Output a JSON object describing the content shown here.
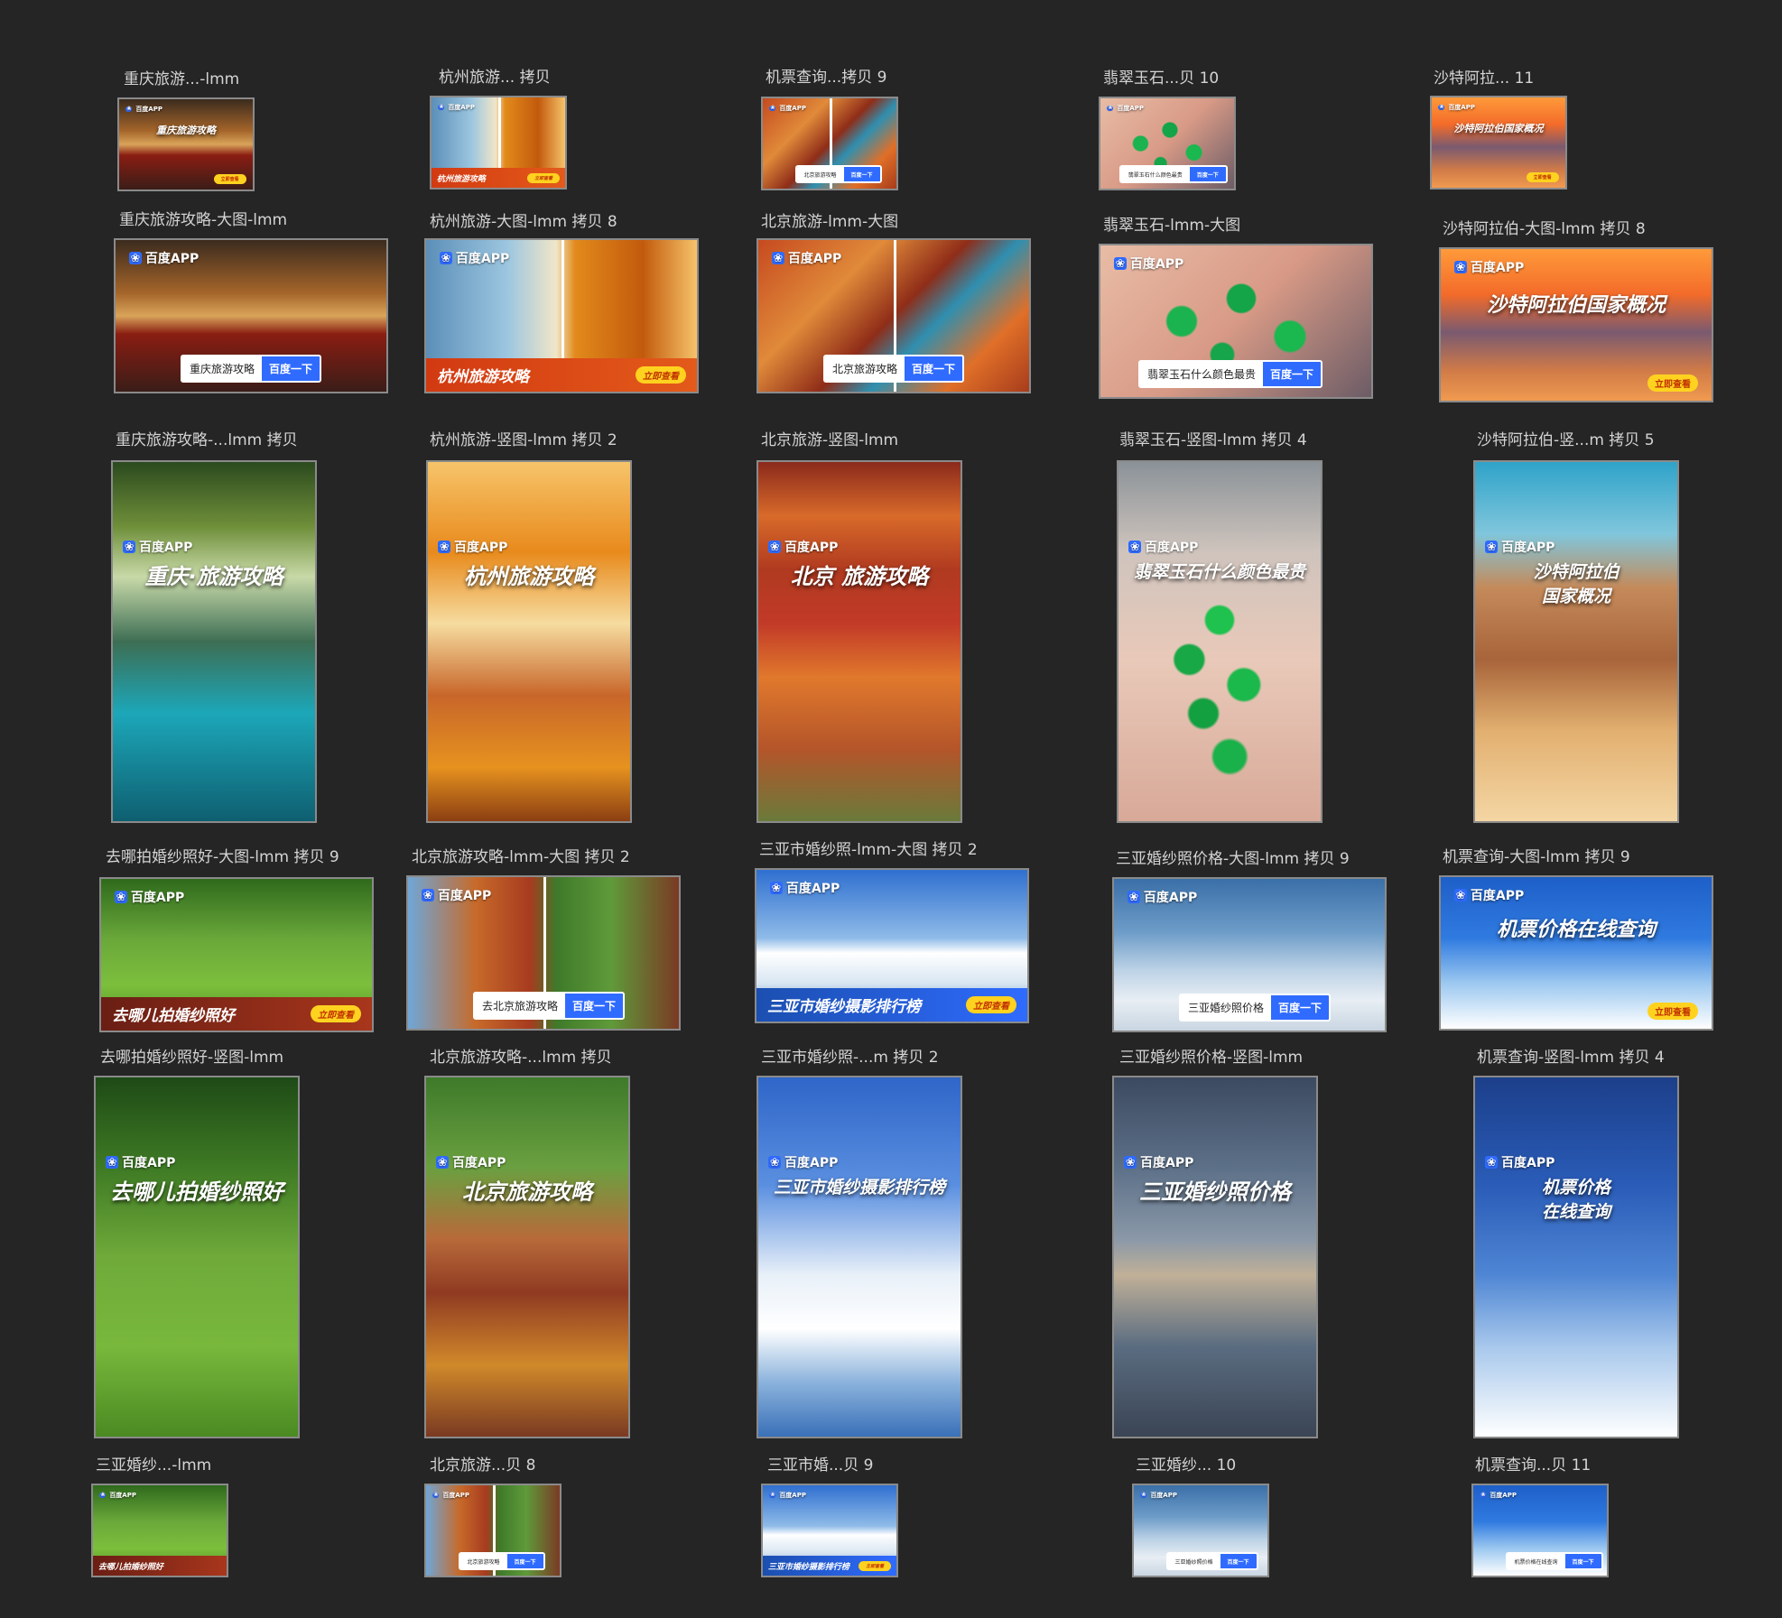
{
  "brand_name": "百度APP",
  "colors": {
    "canvas_bg": "#252526",
    "baidu_blue": "#2f6bff",
    "cta_yellow": "#ffd21f",
    "caption_text": "#d4d4d4"
  },
  "rows": [
    [
      {
        "caption": "重庆旅游...-lmm",
        "theme": "chongqing",
        "headline": "重庆旅游攻略",
        "cta": "立即查看",
        "icon": "image-thumbnail-icon"
      },
      {
        "caption": "杭州旅游... 拷贝",
        "theme": "hangzhou",
        "bar_text": "杭州旅游攻略",
        "cta": "立即查看",
        "icon": "image-thumbnail-icon"
      },
      {
        "caption": "机票查询...拷贝 9",
        "theme": "beijing",
        "search_query": "北京旅游攻略",
        "search_button": "百度一下",
        "icon": "image-thumbnail-icon"
      },
      {
        "caption": "翡翠玉石...贝 10",
        "theme": "jade",
        "search_query": "翡翠玉石什么颜色最贵",
        "search_button": "百度一下",
        "icon": "image-thumbnail-icon"
      },
      {
        "caption": "沙特阿拉... 11",
        "theme": "saudi",
        "headline": "沙特阿拉伯国家概况",
        "cta": "立即查看",
        "icon": "image-thumbnail-icon"
      }
    ],
    [
      {
        "caption": "重庆旅游攻略-大图-lmm",
        "theme": "chongqing",
        "search_query": "重庆旅游攻略",
        "search_button": "百度一下"
      },
      {
        "caption": "杭州旅游-大图-lmm 拷贝 8",
        "theme": "hangzhou",
        "bar_text": "杭州旅游攻略",
        "cta": "立即查看"
      },
      {
        "caption": "北京旅游-lmm-大图",
        "theme": "beijing",
        "search_query": "北京旅游攻略",
        "search_button": "百度一下"
      },
      {
        "caption": "翡翠玉石-lmm-大图",
        "theme": "jade",
        "search_query": "翡翠玉石什么颜色最贵",
        "search_button": "百度一下"
      },
      {
        "caption": "沙特阿拉伯-大图-lmm 拷贝 8",
        "theme": "saudi",
        "headline": "沙特阿拉伯国家概况",
        "cta": "立即查看"
      }
    ],
    [
      {
        "caption": "重庆旅游攻略-...lmm 拷贝",
        "theme": "chongqing-v",
        "headline": "重庆·旅游攻略"
      },
      {
        "caption": "杭州旅游-竖图-lmm 拷贝 2",
        "theme": "hangzhou-v",
        "headline": "杭州旅游攻略"
      },
      {
        "caption": "北京旅游-竖图-lmm",
        "theme": "beijing-v",
        "headline": "北京 旅游攻略"
      },
      {
        "caption": "翡翠玉石-竖图-lmm 拷贝 4",
        "theme": "jade-v",
        "headline": "翡翠玉石什么颜色最贵"
      },
      {
        "caption": "沙特阿拉伯-竖...m 拷贝 5",
        "theme": "saudi-v",
        "headline": "沙特阿拉伯\n国家概况"
      }
    ],
    [
      {
        "caption": "去哪拍婚纱照好-大图-lmm 拷贝 9",
        "theme": "wedding-grass",
        "bar_text": "去哪儿拍婚纱照好",
        "cta": "立即查看"
      },
      {
        "caption": "北京旅游攻略-lmm-大图 拷贝 2",
        "theme": "beijing-pagoda",
        "search_query": "去北京旅游攻略",
        "search_button": "百度一下"
      },
      {
        "caption": "三亚市婚纱照-lmm-大图 拷贝 2",
        "theme": "sanya-arch",
        "bar_text": "三亚市婚纱摄影排行榜",
        "cta": "立即查看"
      },
      {
        "caption": "三亚婚纱照价格-大图-lmm 拷贝 9",
        "theme": "sanya-beach",
        "search_query": "三亚婚纱照价格",
        "search_button": "百度一下"
      },
      {
        "caption": "机票查询-大图-lmm 拷贝 9",
        "theme": "flight",
        "headline": "机票价格在线查询",
        "cta": "立即查看"
      }
    ],
    [
      {
        "caption": "去哪拍婚纱照好-竖图-lmm",
        "theme": "wedding-grass-v",
        "headline": "去哪儿拍婚纱照好"
      },
      {
        "caption": "北京旅游攻略-...lmm 拷贝",
        "theme": "beijing-pagoda-v",
        "headline": "北京旅游攻略"
      },
      {
        "caption": "三亚市婚纱照-...m 拷贝 2",
        "theme": "sanya-arch-v",
        "headline": "三亚市婚纱摄影排行榜"
      },
      {
        "caption": "三亚婚纱照价格-竖图-lmm",
        "theme": "sanya-beach-v",
        "headline": "三亚婚纱照价格"
      },
      {
        "caption": "机票查询-竖图-lmm 拷贝 4",
        "theme": "flight-v",
        "headline": "机票价格\n在线查询"
      }
    ],
    [
      {
        "caption": "三亚婚纱...-lmm",
        "theme": "wedding-grass",
        "bar_text": "去哪儿拍婚纱照好"
      },
      {
        "caption": "北京旅游...贝 8",
        "theme": "beijing-pagoda",
        "search_query": "北京旅游攻略",
        "search_button": "百度一下"
      },
      {
        "caption": "三亚市婚...贝 9",
        "theme": "sanya-arch",
        "bar_text": "三亚市婚纱摄影排行榜",
        "cta": "立即查看"
      },
      {
        "caption": "三亚婚纱... 10",
        "theme": "sanya-beach",
        "search_query": "三亚婚纱照价格",
        "search_button": "百度一下"
      },
      {
        "caption": "机票查询...贝 11",
        "theme": "flight",
        "search_query": "机票价格在线查询",
        "search_button": "百度一下"
      }
    ]
  ]
}
